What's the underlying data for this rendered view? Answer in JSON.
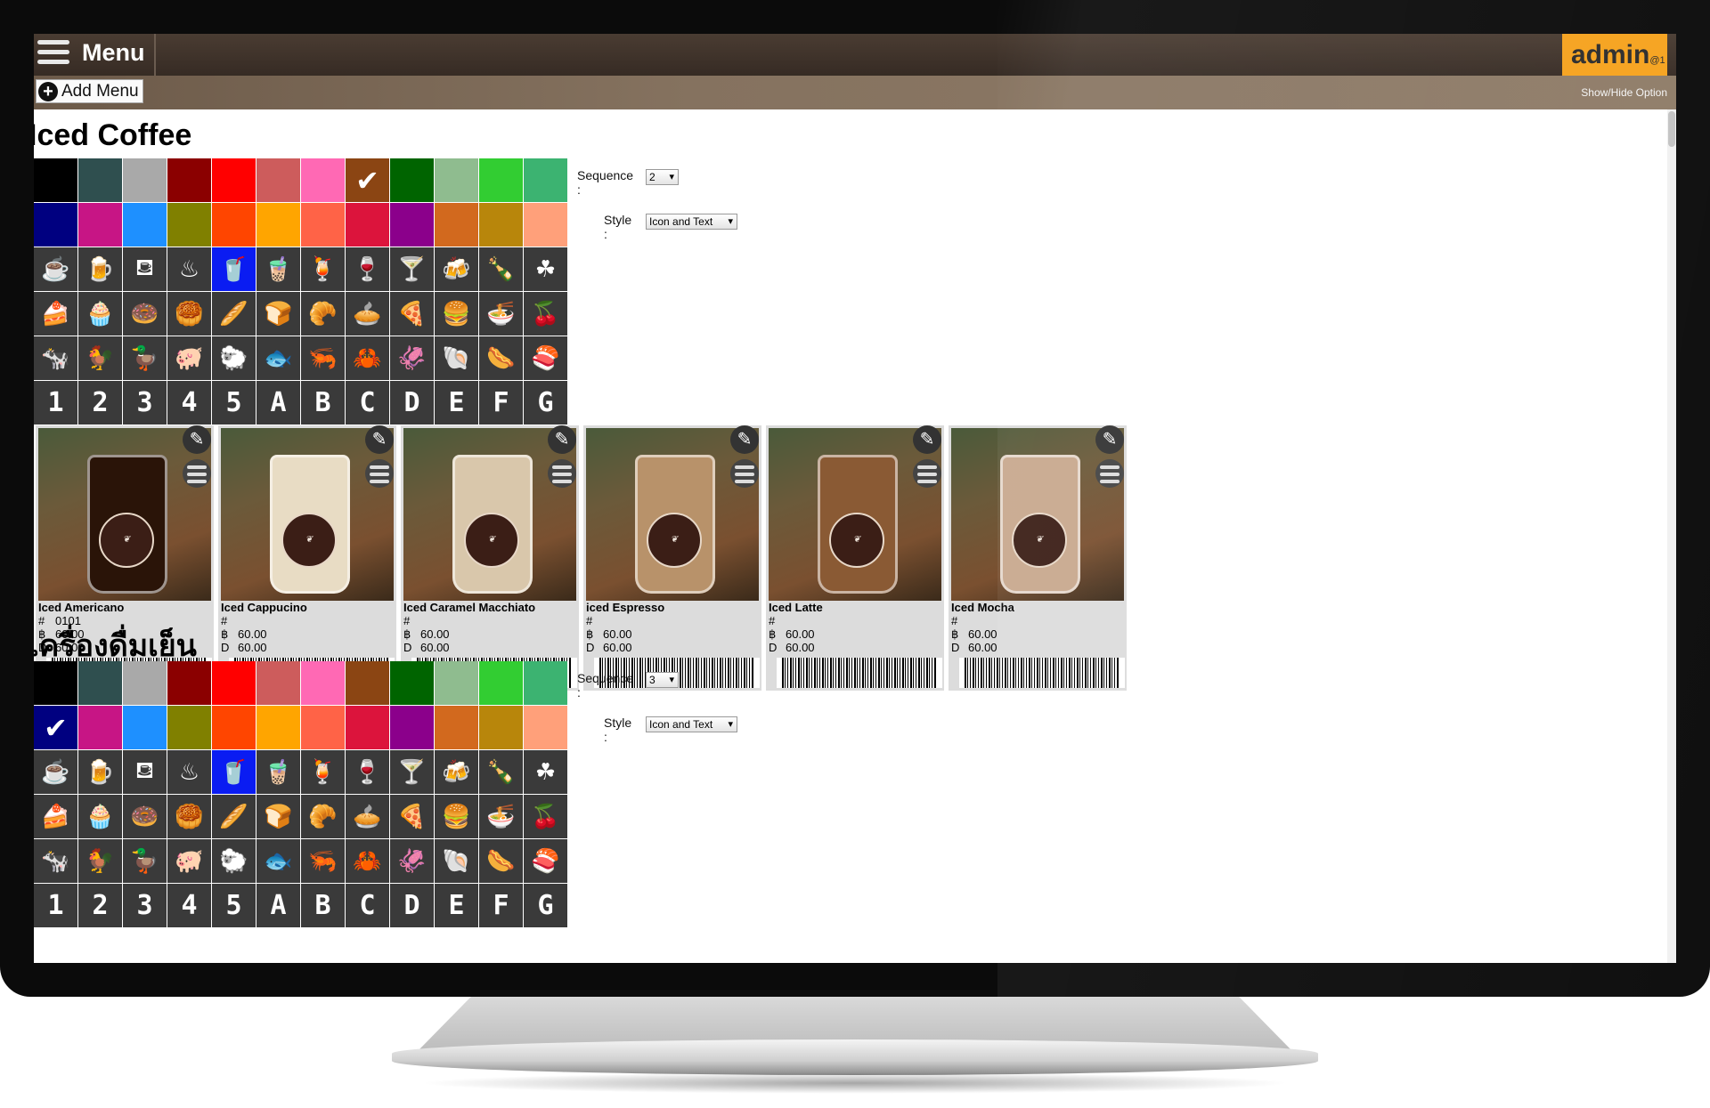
{
  "header": {
    "title": "Menu",
    "user": "admin",
    "user_suffix": "@1"
  },
  "toolbar": {
    "add_menu_label": "Add Menu",
    "show_hide_label": "Show/Hide Option"
  },
  "icons": {
    "drinks": [
      "hot-coffee-icon",
      "mug-icon",
      "coffee-cup-icon",
      "beer-mug-icon",
      "iced-drink-icon",
      "iced-tea-icon",
      "smoothie-icon",
      "wine-glass-icon",
      "cocktail-icon",
      "beer-icon",
      "bottle-icon",
      "coffee-beans-icon"
    ],
    "food": [
      "cake-slice-icon",
      "cupcake-icon",
      "donut-icon",
      "muffin-icon",
      "bread-icon",
      "toast-icon",
      "croissant-icon",
      "pie-icon",
      "pizza-icon",
      "burger-icon",
      "noodle-bowl-icon",
      "cherry-icon"
    ],
    "meat": [
      "cow-icon",
      "chicken-icon",
      "duck-icon",
      "pig-icon",
      "sheep-icon",
      "fish-icon",
      "shrimp-icon",
      "crab-icon",
      "squid-icon",
      "shell-icon",
      "sausage-icon",
      "roll-icon"
    ]
  },
  "chars": [
    "1",
    "2",
    "3",
    "4",
    "5",
    "A",
    "B",
    "C",
    "D",
    "E",
    "F",
    "G"
  ],
  "colors": [
    "#000000",
    "#2f4f4f",
    "#a9a9a9",
    "#8b0000",
    "#ff0000",
    "#cd5c5c",
    "#ff69b4",
    "#8b4513",
    "#006400",
    "#8fbc8f",
    "#32cd32",
    "#3cb371",
    "#000080",
    "#c71585",
    "#1e90ff",
    "#808000",
    "#ff4500",
    "#ffa500",
    "#ff6347",
    "#dc143c",
    "#8b008b",
    "#d2691e",
    "#b8860b",
    "#ffa07a"
  ],
  "sections": [
    {
      "title": "Iced Coffee",
      "sequence_label": "Sequence :",
      "sequence_value": "2",
      "style_label": "Style :",
      "style_value": "Icon and Text",
      "selected_color_index": 7,
      "selected_icon": "iced-drink-icon",
      "items": [
        {
          "name": "Iced Americano",
          "code_label": "#",
          "code": "0101",
          "price_label": "฿",
          "price": "60.00",
          "d_label": "D",
          "d_price": "60.00",
          "color": "#2a1408"
        },
        {
          "name": "Iced Cappucino",
          "code_label": "#",
          "code": "",
          "price_label": "฿",
          "price": "60.00",
          "d_label": "D",
          "d_price": "60.00",
          "color": "#e8dcc4"
        },
        {
          "name": "Iced Caramel Macchiato",
          "code_label": "#",
          "code": "",
          "price_label": "฿",
          "price": "60.00",
          "d_label": "D",
          "d_price": "60.00",
          "color": "#d9c7ab"
        },
        {
          "name": "iced Espresso",
          "code_label": "#",
          "code": "",
          "price_label": "฿",
          "price": "60.00",
          "d_label": "D",
          "d_price": "60.00",
          "color": "#b8926a"
        },
        {
          "name": "Iced Latte",
          "code_label": "#",
          "code": "",
          "price_label": "฿",
          "price": "60.00",
          "d_label": "D",
          "d_price": "60.00",
          "color": "#8a5a34"
        },
        {
          "name": "Iced Mocha",
          "code_label": "#",
          "code": "",
          "price_label": "฿",
          "price": "60.00",
          "d_label": "D",
          "d_price": "60.00",
          "color": "#c8a88e"
        }
      ]
    },
    {
      "title": "เครื่องดื่มเย็น",
      "sequence_label": "Sequence :",
      "sequence_value": "3",
      "style_label": "Style :",
      "style_value": "Icon and Text",
      "selected_color_index": 12,
      "selected_icon": "iced-drink-icon"
    }
  ]
}
